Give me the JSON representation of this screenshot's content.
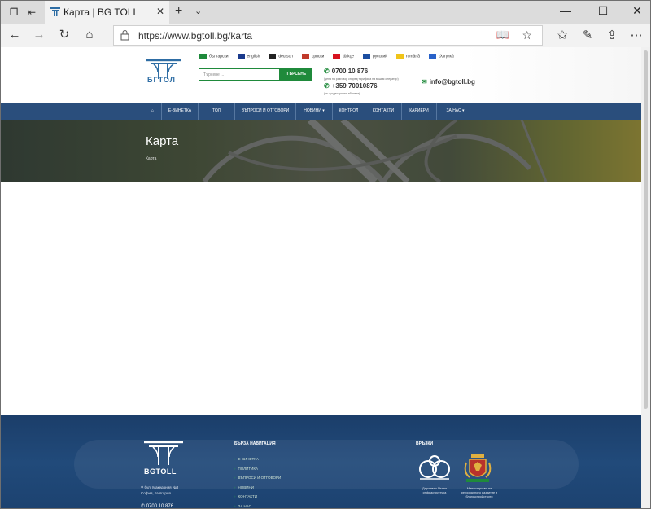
{
  "browser": {
    "tab_title": "Карта | BG TOLL",
    "url": "https://www.bgtoll.bg/karta"
  },
  "header": {
    "logo_text": "БГТОЛ",
    "languages": [
      {
        "label": "български",
        "flag_color": "#1f8a3b"
      },
      {
        "label": "english",
        "flag_color": "#1a3a8c"
      },
      {
        "label": "deutsch",
        "flag_color": "#222222"
      },
      {
        "label": "српски",
        "flag_color": "#c0392b"
      },
      {
        "label": "türkçe",
        "flag_color": "#d7121f"
      },
      {
        "label": "русский",
        "flag_color": "#1b4ea0"
      },
      {
        "label": "română",
        "flag_color": "#f0c419"
      },
      {
        "label": "ελληνικά",
        "flag_color": "#2962c9"
      }
    ],
    "search_placeholder": "Търсене ...",
    "search_button": "ТЪРСЕНЕ",
    "phone1": "0700 10 876",
    "phone1_note": "(цена на разговор според тарифата на вашия оператор)",
    "phone2": "+359 70010876",
    "phone2_note": "(за чуждестранни абонати)",
    "email": "info@bgtoll.bg"
  },
  "nav": {
    "items": [
      "⌂",
      "Е-ВИНЕТКА",
      "ТОЛ",
      "ВЪПРОСИ И ОТГОВОРИ",
      "НОВИНИ ▾",
      "КОНТРОЛ",
      "КОНТАКТИ",
      "КАРИЕРИ",
      "ЗА НАС ▾"
    ]
  },
  "hero": {
    "title": "Карта",
    "breadcrumb": "Карта"
  },
  "footer": {
    "logo_text": "BGTOLL",
    "address_line1": "бул. Македония №3",
    "address_line2": "София, България",
    "phone": "0700 10 876",
    "quick_nav_title": "БЪРЗА НАВИГАЦИЯ",
    "links": [
      "Е-ВИНЕТКА",
      "ПОЛИТИКА",
      "ВЪПРОСИ И ОТГОВОРИ",
      "НОВИНИ",
      "КОНТАКТИ",
      "ЗА НАС"
    ],
    "partners_title": "ВРЪЗКИ",
    "partner1_caption": "Държавно Пътна инфраструктура",
    "partner2_caption": "Министерство на регионалното развитие и благоустройството"
  },
  "colors": {
    "nav_blue": "#2a4e7c",
    "accent_green": "#1f8a3b",
    "footer_blue": "#1b3e6a"
  }
}
